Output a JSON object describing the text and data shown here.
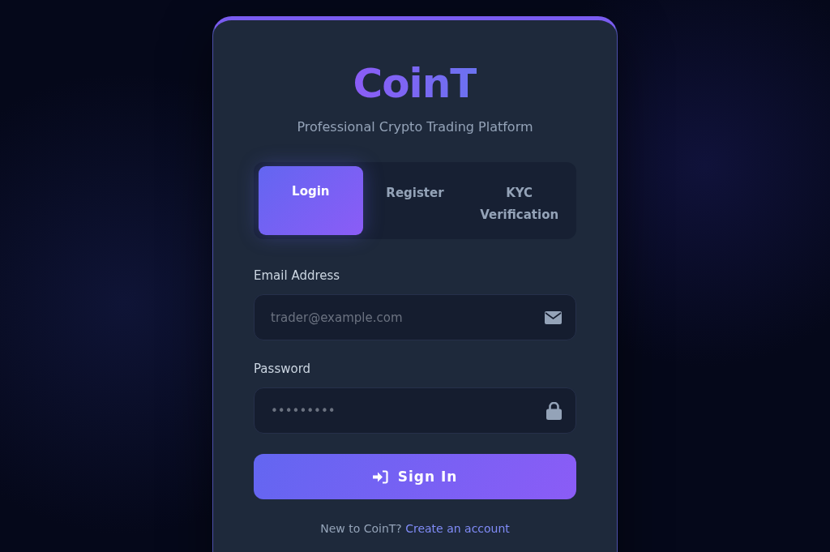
{
  "brand": {
    "logo": "CoinT",
    "tagline": "Professional Crypto Trading Platform"
  },
  "tabs": [
    {
      "label": "Login",
      "selected": true
    },
    {
      "label": "Register",
      "selected": false
    },
    {
      "label": "KYC Verification",
      "selected": false
    }
  ],
  "fields": [
    {
      "label": "Email Address",
      "placeholder": "trader@example.com",
      "kind": "email"
    },
    {
      "label": "Password",
      "placeholder": "•••••••••",
      "kind": "password"
    }
  ],
  "submit": {
    "label": "Sign In"
  },
  "footer": {
    "text": "New to CoinT?",
    "link": "Create an account"
  }
}
